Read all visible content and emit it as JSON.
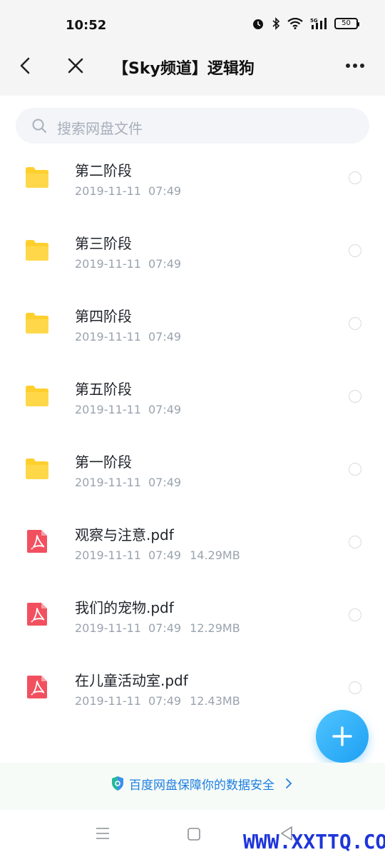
{
  "status": {
    "time": "10:52",
    "battery": "50"
  },
  "header": {
    "title": "【Sky频道】逻辑狗"
  },
  "search": {
    "placeholder": "搜索网盘文件"
  },
  "files": [
    {
      "name": "第二阶段",
      "type": "folder",
      "date": "2019-11-11",
      "time": "07:49",
      "size": ""
    },
    {
      "name": "第三阶段",
      "type": "folder",
      "date": "2019-11-11",
      "time": "07:49",
      "size": ""
    },
    {
      "name": "第四阶段",
      "type": "folder",
      "date": "2019-11-11",
      "time": "07:49",
      "size": ""
    },
    {
      "name": "第五阶段",
      "type": "folder",
      "date": "2019-11-11",
      "time": "07:49",
      "size": ""
    },
    {
      "name": "第一阶段",
      "type": "folder",
      "date": "2019-11-11",
      "time": "07:49",
      "size": ""
    },
    {
      "name": "观察与注意.pdf",
      "type": "pdf",
      "date": "2019-11-11",
      "time": "07:49",
      "size": "14.29MB"
    },
    {
      "name": "我们的宠物.pdf",
      "type": "pdf",
      "date": "2019-11-11",
      "time": "07:49",
      "size": "12.29MB"
    },
    {
      "name": "在儿童活动室.pdf",
      "type": "pdf",
      "date": "2019-11-11",
      "time": "07:49",
      "size": "12.43MB"
    }
  ],
  "footer": {
    "security_text": "百度网盘保障你的数据安全"
  },
  "watermark": "WWW.XXTTQ.COM",
  "colors": {
    "folder": "#ffcf2e",
    "pdf": "#f2505f",
    "accent": "#1ea0f3",
    "link": "#1d7ee0"
  }
}
